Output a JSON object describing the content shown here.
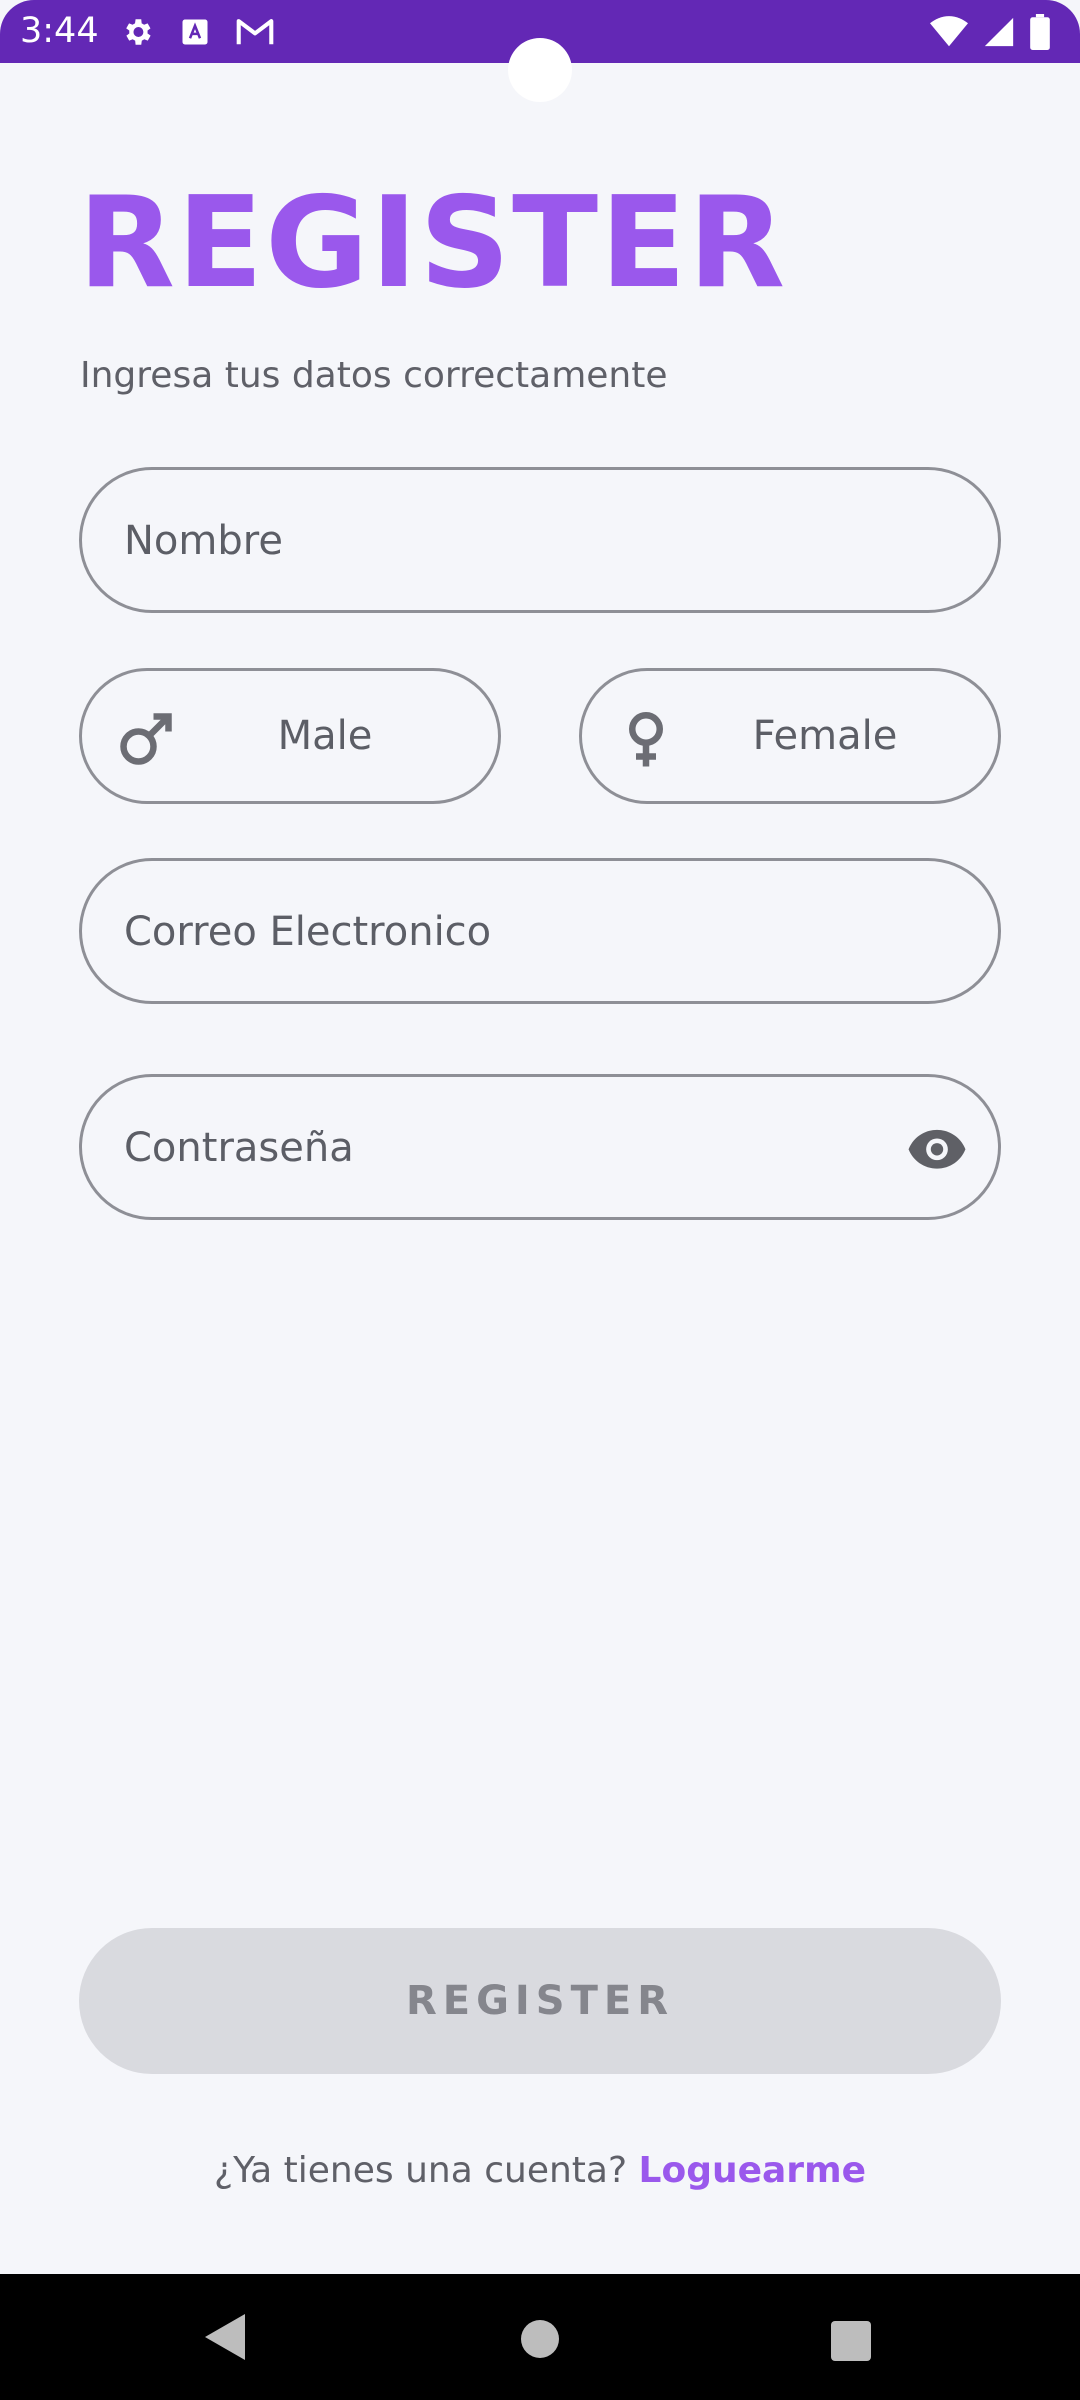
{
  "status_bar": {
    "time": "3:44",
    "left_icons": [
      "gear-icon",
      "a-icon",
      "gmail-icon"
    ],
    "right_icons": [
      "wifi-icon",
      "signal-icon",
      "battery-icon"
    ],
    "background": "#6328b5"
  },
  "header": {
    "title": "REGISTER",
    "subtitle": "Ingresa tus datos correctamente",
    "accent_color": "#9a58ec"
  },
  "form": {
    "name_placeholder": "Nombre",
    "gender": {
      "male_label": "Male",
      "female_label": "Female"
    },
    "email_placeholder": "Correo Electronico",
    "password_placeholder": "Contraseña"
  },
  "actions": {
    "register_label": "REGISTER"
  },
  "footer": {
    "prompt": "¿Ya tienes una cuenta?",
    "link": "Loguearme"
  },
  "nav_bar": {
    "icons": [
      "back-icon",
      "home-icon",
      "recents-icon"
    ]
  }
}
